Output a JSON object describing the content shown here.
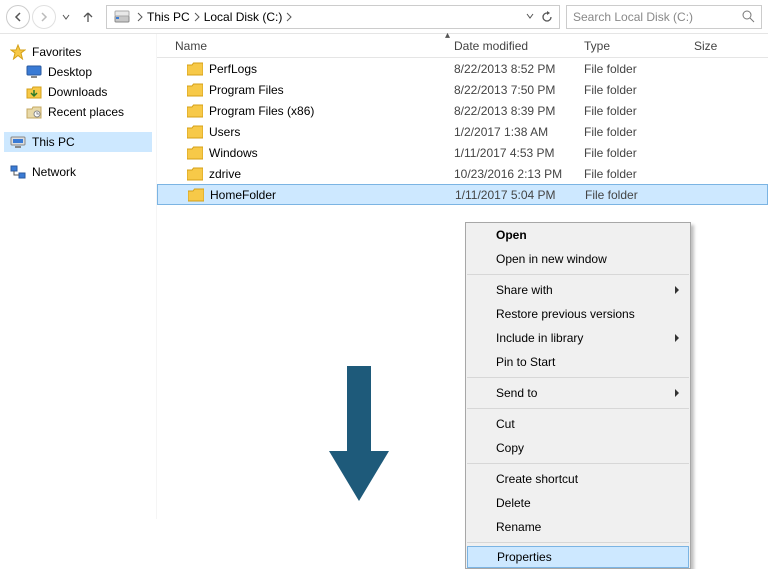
{
  "colors": {
    "highlight": "#cde8ff",
    "arrow": "#1e5a7a"
  },
  "breadcrumb": {
    "root": "This PC",
    "location": "Local Disk (C:)"
  },
  "search": {
    "placeholder": "Search Local Disk (C:)"
  },
  "sidebar": {
    "favorites": {
      "label": "Favorites",
      "items": [
        {
          "label": "Desktop"
        },
        {
          "label": "Downloads"
        },
        {
          "label": "Recent places"
        }
      ]
    },
    "this_pc": {
      "label": "This PC"
    },
    "network": {
      "label": "Network"
    }
  },
  "columns": {
    "name": "Name",
    "date": "Date modified",
    "type": "Type",
    "size": "Size"
  },
  "rows": [
    {
      "name": "PerfLogs",
      "date": "8/22/2013 8:52 PM",
      "type": "File folder"
    },
    {
      "name": "Program Files",
      "date": "8/22/2013 7:50 PM",
      "type": "File folder"
    },
    {
      "name": "Program Files (x86)",
      "date": "8/22/2013 8:39 PM",
      "type": "File folder"
    },
    {
      "name": "Users",
      "date": "1/2/2017 1:38 AM",
      "type": "File folder"
    },
    {
      "name": "Windows",
      "date": "1/11/2017 4:53 PM",
      "type": "File folder"
    },
    {
      "name": "zdrive",
      "date": "10/23/2016 2:13 PM",
      "type": "File folder"
    },
    {
      "name": "HomeFolder",
      "date": "1/11/2017 5:04 PM",
      "type": "File folder",
      "selected": true
    }
  ],
  "context_menu": {
    "items": [
      {
        "label": "Open",
        "bold": true
      },
      {
        "label": "Open in new window"
      },
      {
        "sep": true
      },
      {
        "label": "Share with",
        "submenu": true
      },
      {
        "label": "Restore previous versions"
      },
      {
        "label": "Include in library",
        "submenu": true
      },
      {
        "label": "Pin to Start"
      },
      {
        "sep": true
      },
      {
        "label": "Send to",
        "submenu": true
      },
      {
        "sep": true
      },
      {
        "label": "Cut"
      },
      {
        "label": "Copy"
      },
      {
        "sep": true
      },
      {
        "label": "Create shortcut"
      },
      {
        "label": "Delete"
      },
      {
        "label": "Rename"
      },
      {
        "sep": true
      },
      {
        "label": "Properties",
        "highlighted": true
      }
    ]
  }
}
